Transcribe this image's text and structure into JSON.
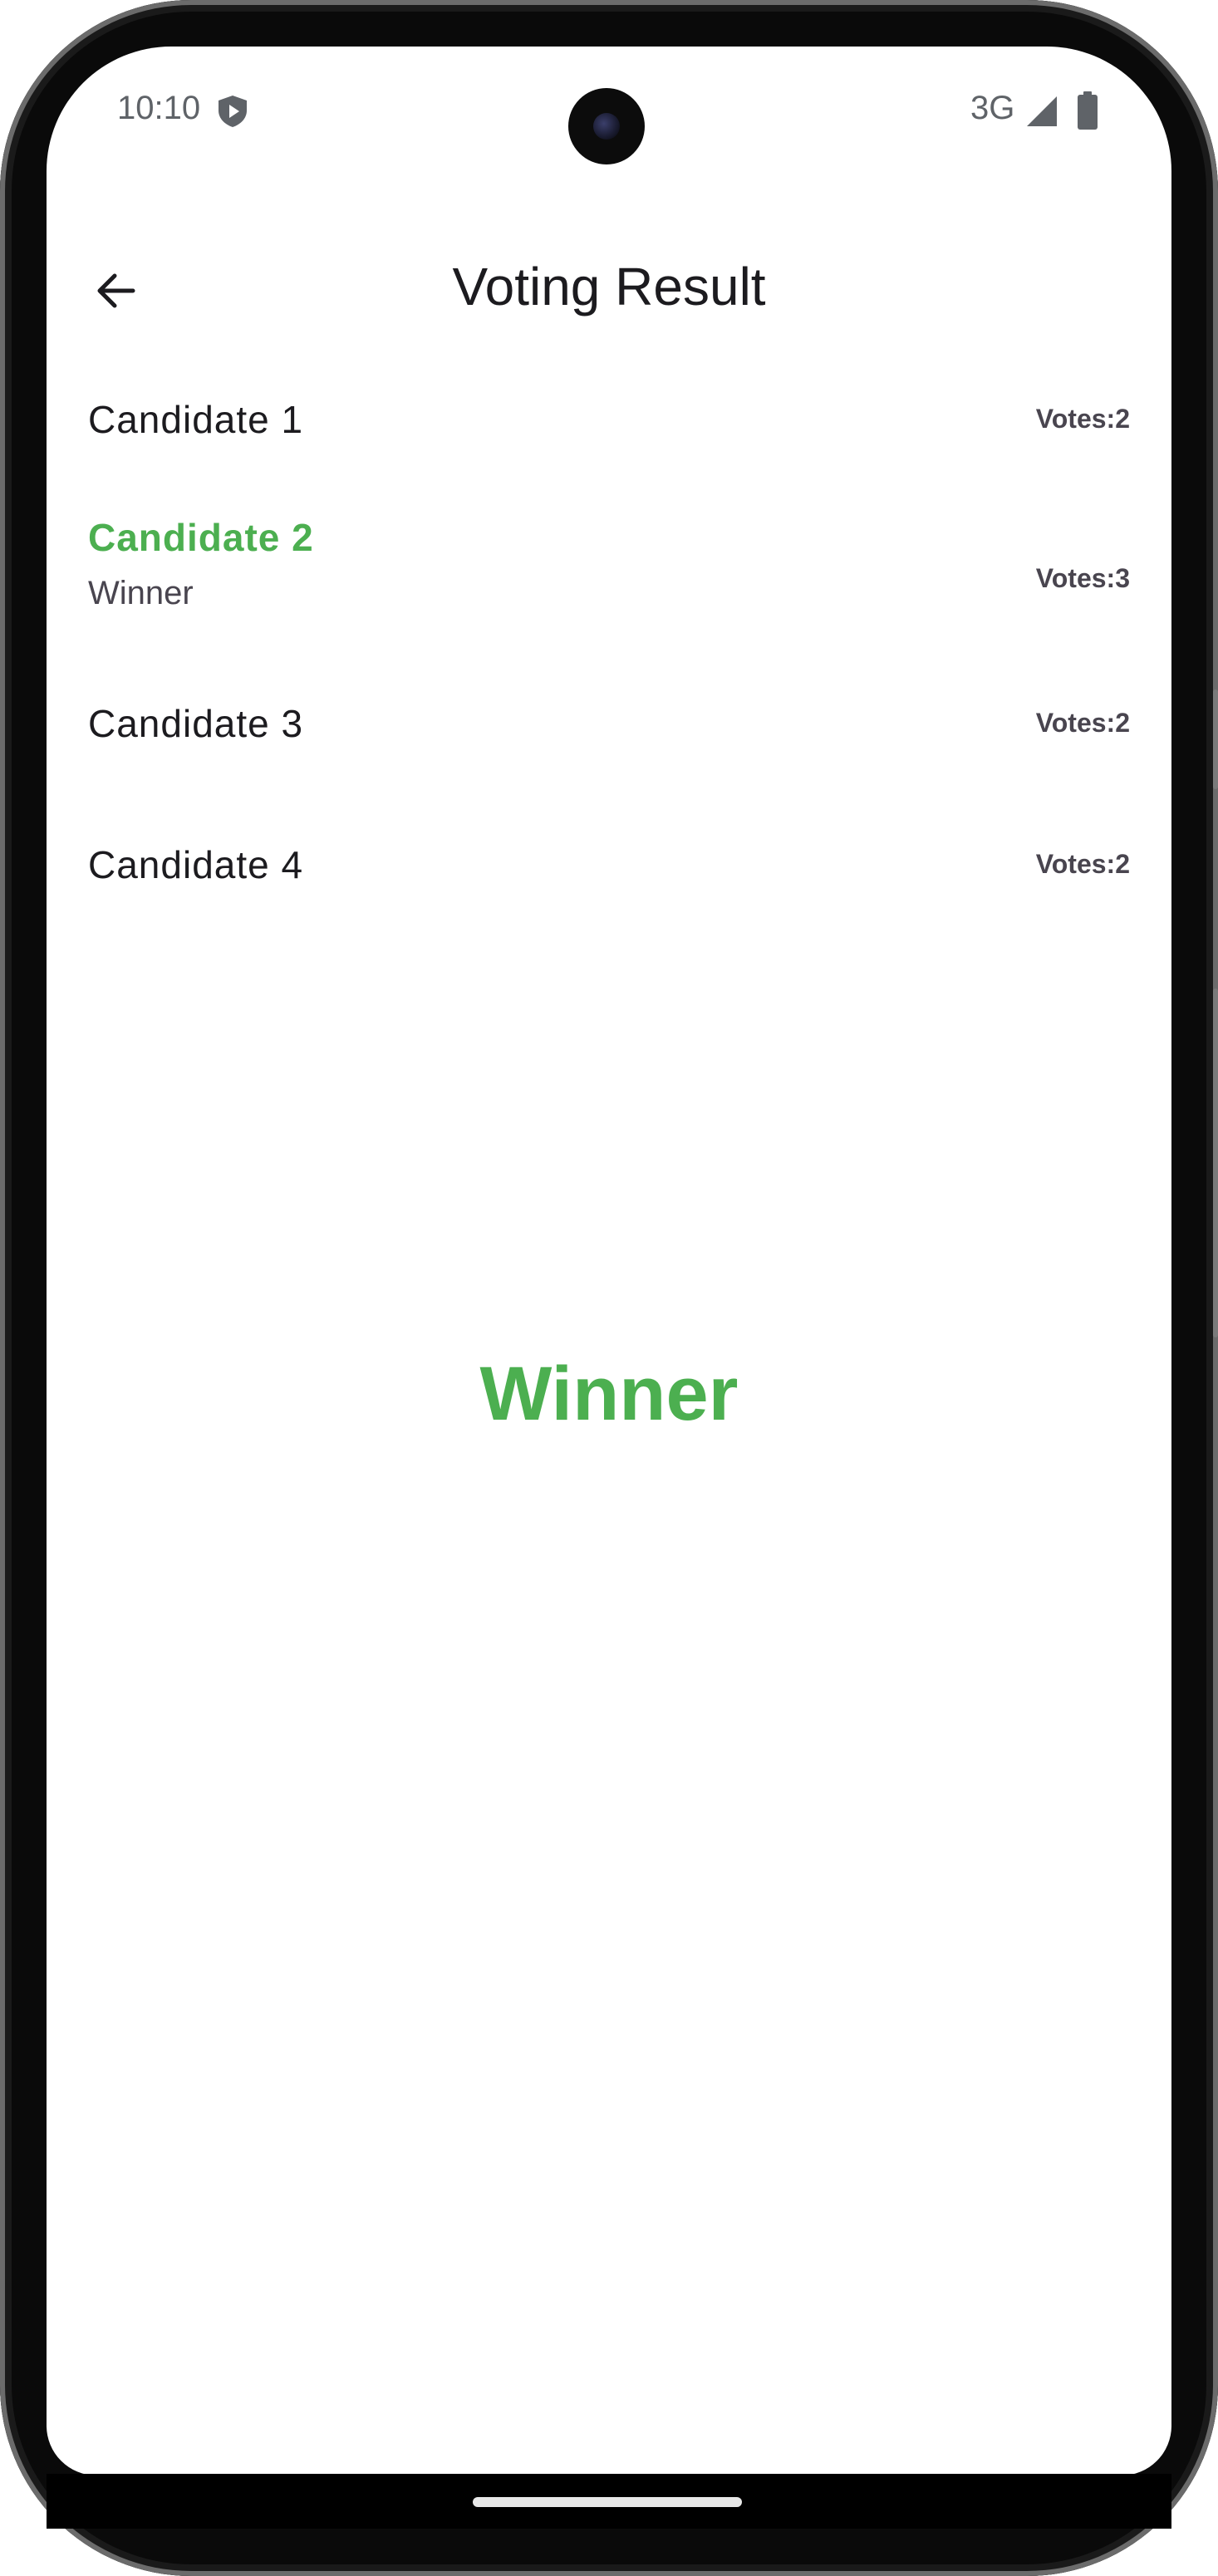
{
  "status_bar": {
    "time": "10:10",
    "network": "3G",
    "icons": [
      "shield-icon",
      "signal-icon",
      "battery-icon"
    ]
  },
  "app_bar": {
    "title": "Voting Result",
    "back_icon": "arrow-left-icon"
  },
  "candidates": [
    {
      "name": "Candidate 1",
      "votes": "Votes:2",
      "subtitle": ""
    },
    {
      "name": "Candidate 2",
      "votes": "Votes:3",
      "subtitle": "Winner"
    },
    {
      "name": "Candidate 3",
      "votes": "Votes:2",
      "subtitle": ""
    },
    {
      "name": "Candidate 4",
      "votes": "Votes:2",
      "subtitle": ""
    }
  ],
  "result": {
    "label": "Winner"
  },
  "colors": {
    "winner": "#4caf50",
    "text_primary": "#1c1b1f",
    "text_secondary": "#49454f",
    "status_text": "#5f6368"
  }
}
